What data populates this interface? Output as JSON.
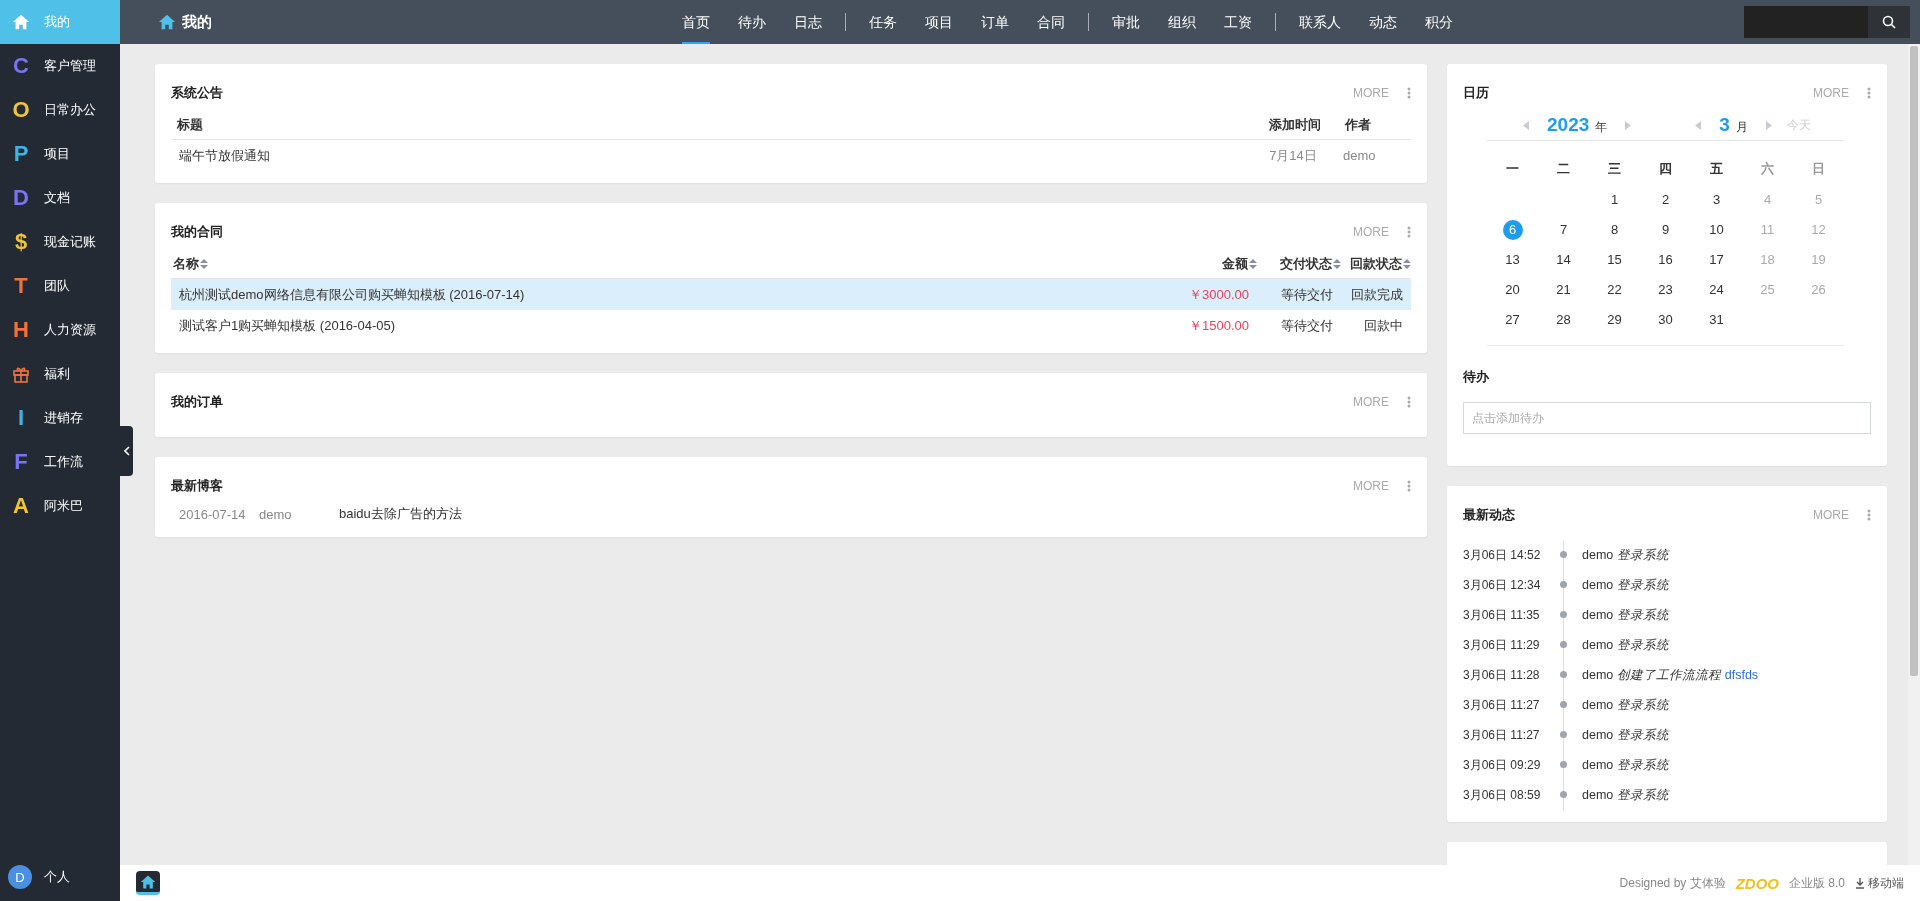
{
  "sidebar": {
    "items": [
      {
        "kind": "home",
        "label": "我的",
        "selected": true
      },
      {
        "kind": "letter",
        "letter": "C",
        "label": "客户管理",
        "color": "#7b74f0",
        "selected": false
      },
      {
        "kind": "letter",
        "letter": "O",
        "label": "日常办公",
        "color": "#f2c438",
        "selected": false
      },
      {
        "kind": "letter",
        "letter": "P",
        "label": "项目",
        "color": "#3bb5e3",
        "selected": false
      },
      {
        "kind": "letter",
        "letter": "D",
        "label": "文档",
        "color": "#7b74f0",
        "selected": false
      },
      {
        "kind": "letter",
        "letter": "$",
        "label": "现金记账",
        "color": "#f2c438",
        "selected": false
      },
      {
        "kind": "letter",
        "letter": "T",
        "label": "团队",
        "color": "#f0733a",
        "selected": false
      },
      {
        "kind": "letter",
        "letter": "H",
        "label": "人力资源",
        "color": "#f0733a",
        "selected": false
      },
      {
        "kind": "gift",
        "label": "福利",
        "color": "#f0733a",
        "selected": false
      },
      {
        "kind": "letter",
        "letter": "I",
        "label": "进销存",
        "color": "#3bb5e3",
        "selected": false
      },
      {
        "kind": "letter",
        "letter": "F",
        "label": "工作流",
        "color": "#7b74f0",
        "selected": false
      },
      {
        "kind": "letter",
        "letter": "A",
        "label": "阿米巴",
        "color": "#f2c438",
        "selected": false
      }
    ],
    "user": {
      "initial": "D",
      "label": "个人"
    }
  },
  "topbar": {
    "title": "我的",
    "nav": [
      [
        {
          "label": "首页",
          "selected": true
        },
        {
          "label": "待办",
          "selected": false
        },
        {
          "label": "日志",
          "selected": false
        }
      ],
      [
        {
          "label": "任务",
          "selected": false
        },
        {
          "label": "项目",
          "selected": false
        },
        {
          "label": "订单",
          "selected": false
        },
        {
          "label": "合同",
          "selected": false
        }
      ],
      [
        {
          "label": "审批",
          "selected": false
        },
        {
          "label": "组织",
          "selected": false
        },
        {
          "label": "工资",
          "selected": false
        }
      ],
      [
        {
          "label": "联系人",
          "selected": false
        },
        {
          "label": "动态",
          "selected": false
        },
        {
          "label": "积分",
          "selected": false
        }
      ]
    ]
  },
  "announcements": {
    "title": "系统公告",
    "more": "MORE",
    "columns": [
      "标题",
      "添加时间",
      "作者"
    ],
    "rows": [
      {
        "title": "端午节放假通知",
        "date": "7月14日",
        "author": "demo"
      }
    ]
  },
  "contracts": {
    "title": "我的合同",
    "more": "MORE",
    "columns": [
      "名称",
      "金额",
      "交付状态",
      "回款状态"
    ],
    "rows": [
      {
        "name": "杭州测试demo网络信息有限公司购买蝉知模板 (2016-07-14)",
        "amount": "￥3000.00",
        "delivery": "等待交付",
        "payment": "回款完成",
        "selected": true
      },
      {
        "name": "测试客户1购买蝉知模板 (2016-04-05)",
        "amount": "￥1500.00",
        "delivery": "等待交付",
        "payment": "回款中",
        "selected": false
      }
    ]
  },
  "orders": {
    "title": "我的订单",
    "more": "MORE"
  },
  "blogs": {
    "title": "最新博客",
    "more": "MORE",
    "rows": [
      {
        "date": "2016-07-14",
        "author": "demo",
        "title": "baidu去除广告的方法"
      }
    ]
  },
  "calendar": {
    "title": "日历",
    "more": "MORE",
    "year": "2023",
    "year_unit": "年",
    "month": "3",
    "month_unit": "月",
    "today": "今天",
    "weekdays": [
      "一",
      "二",
      "三",
      "四",
      "五",
      "六",
      "日"
    ],
    "weeks": [
      [
        {
          "text": "1",
          "selected": false
        },
        {
          "text": "2",
          "selected": false
        },
        {
          "text": "3",
          "selected": false
        },
        {
          "text": "4",
          "selected": false
        },
        {
          "text": "5",
          "selected": false
        }
      ],
      [
        {
          "text": "6",
          "selected": true
        },
        {
          "text": "7",
          "selected": false
        },
        {
          "text": "8",
          "selected": false
        },
        {
          "text": "9",
          "selected": false
        },
        {
          "text": "10",
          "selected": false
        },
        {
          "text": "11",
          "selected": false
        },
        {
          "text": "12",
          "selected": false
        }
      ],
      [
        {
          "text": "13",
          "selected": false
        },
        {
          "text": "14",
          "selected": false
        },
        {
          "text": "15",
          "selected": false
        },
        {
          "text": "16",
          "selected": false
        },
        {
          "text": "17",
          "selected": false
        },
        {
          "text": "18",
          "selected": false
        },
        {
          "text": "19",
          "selected": false
        }
      ],
      [
        {
          "text": "20",
          "selected": false
        },
        {
          "text": "21",
          "selected": false
        },
        {
          "text": "22",
          "selected": false
        },
        {
          "text": "23",
          "selected": false
        },
        {
          "text": "24",
          "selected": false
        },
        {
          "text": "25",
          "selected": false
        },
        {
          "text": "26",
          "selected": false
        }
      ],
      [
        {
          "text": "27",
          "selected": false
        },
        {
          "text": "28",
          "selected": false
        },
        {
          "text": "29",
          "selected": false
        },
        {
          "text": "30",
          "selected": false
        },
        {
          "text": "31",
          "selected": false
        }
      ]
    ],
    "todo_title": "待办",
    "todo_placeholder": "点击添加待办"
  },
  "activity": {
    "title": "最新动态",
    "more": "MORE",
    "rows": [
      {
        "time": "3月06日 14:52",
        "user": "demo",
        "action": "登录系统"
      },
      {
        "time": "3月06日 12:34",
        "user": "demo",
        "action": "登录系统"
      },
      {
        "time": "3月06日 11:35",
        "user": "demo",
        "action": "登录系统"
      },
      {
        "time": "3月06日 11:29",
        "user": "demo",
        "action": "登录系统"
      },
      {
        "time": "3月06日 11:28",
        "user": "demo",
        "action": "创建了工作流流程",
        "link": "dfsfds"
      },
      {
        "time": "3月06日 11:27",
        "user": "demo",
        "action": "登录系统"
      },
      {
        "time": "3月06日 11:27",
        "user": "demo",
        "action": "登录系统"
      },
      {
        "time": "3月06日 09:29",
        "user": "demo",
        "action": "登录系统"
      },
      {
        "time": "3月06日 08:59",
        "user": "demo",
        "action": "登录系统"
      }
    ]
  },
  "footer": {
    "designed_by": "Designed by 艾体验",
    "logo": "ZDOO",
    "edition": "企业版 8.0",
    "mobile": "移动端"
  }
}
